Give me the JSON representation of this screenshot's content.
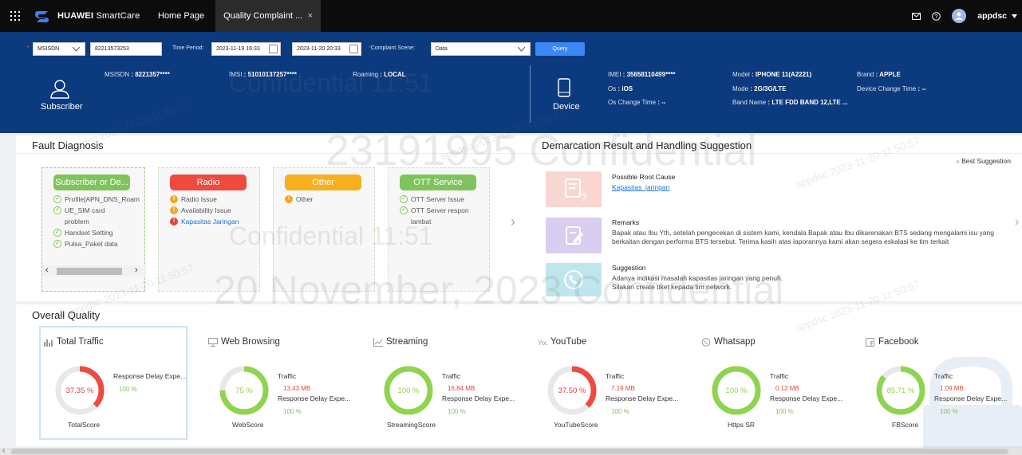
{
  "topbar": {
    "app_name_bold": "HUAWEI",
    "app_name_rest": " SmartCare",
    "tabs": [
      {
        "label": "Home Page"
      },
      {
        "label": "Quality Complaint ..."
      }
    ],
    "close_glyph": "×",
    "user": "appdsc",
    "icons": [
      "apps-grid-icon",
      "mail-icon",
      "help-icon",
      "user-icon",
      "caret-down-icon"
    ]
  },
  "query": {
    "type_select": "MSISDN",
    "msisdn_value": "82213573253",
    "time_period_label": "Time Period:",
    "start_time": "2023-11-19 16:33",
    "end_time": "2023-11-20 20:33",
    "scene_label": "Complaint Scene:",
    "scene_value": "Data",
    "query_button": "Query"
  },
  "subscriber": {
    "label": "Subscriber",
    "msisdn_key": "MSISDN",
    "msisdn_val": "8221357****",
    "imsi_key": "IMSI",
    "imsi_val": "51010137257****",
    "roaming_key": "Roaming",
    "roaming_val": "LOCAL"
  },
  "device": {
    "label": "Device",
    "imei_key": "IMEI",
    "imei_val": "35658110499****",
    "os_key": "Os",
    "os_val": "iOS",
    "os_change_key": "Os Change Time",
    "os_change_val": "--",
    "model_key": "Model",
    "model_val": "IPHONE 11(A2221)",
    "mode_key": "Mode",
    "mode_val": "2G/3G/LTE",
    "band_key": "Band Name",
    "band_val": "LTE FDD BAND 12,LTE ...",
    "brand_key": "Brand",
    "brand_val": "APPLE",
    "dev_change_key": "Device Change Time",
    "dev_change_val": "--"
  },
  "fault": {
    "title": "Fault Diagnosis",
    "cards": [
      {
        "title": "Subscriber or De...",
        "color": "#7ec45a",
        "items": [
          "Profile[APN_DNS_Roam",
          "UE_SIM card problem",
          "Handset Setting",
          "Pulsa_Paket data"
        ]
      },
      {
        "title": "Radio",
        "color": "#f0493e",
        "items": [
          "Radio Issue",
          "Availability Issue",
          "Kapasitas Jaringan"
        ]
      },
      {
        "title": "Other",
        "color": "#f6b01e",
        "items": [
          "Other"
        ]
      },
      {
        "title": "OTT Service",
        "color": "#7ec45a",
        "items": [
          "OTT Server Issue",
          "OTT Server respon lambat"
        ]
      }
    ]
  },
  "demarcation": {
    "title": "Demarcation Result and Handling Suggestion",
    "best": "Best Suggestion",
    "root_title": "Possible Root Cause",
    "root_link": "Kapasitas_jaringan",
    "remarks_title": "Remarks",
    "remarks_text": "Bapak atau Ibu Yth, setelah pengecekan di sistem kami, kendala Bapak atau Ibu dikarenakan BTS sedang mengalami isu yang berkaitan dengan performa BTS tersebut. Terima kasih atas laporannya kami akan segera eskalasi ke tim terkait",
    "sugg_title": "Suggestion",
    "sugg_line1": "Adanya indikasi masalah kapasitas jaringan yang penuh.",
    "sugg_line2": "Silakan create tiket kepada tim network."
  },
  "overall": {
    "title": "Overall Quality",
    "tabs": [
      {
        "label": "Total Traffic",
        "icon": "bar-chart-icon"
      },
      {
        "label": "Web Browsing",
        "icon": "monitor-icon"
      },
      {
        "label": "Streaming",
        "icon": "line-chart-icon"
      },
      {
        "label": "YouTube",
        "icon": "youtube-icon"
      },
      {
        "label": "Whatsapp",
        "icon": "whatsapp-icon"
      },
      {
        "label": "Facebook",
        "icon": "facebook-icon"
      }
    ],
    "scores": [
      {
        "pct_label": "37.35 %",
        "value": 37.35,
        "color": "#f0493e",
        "score_label": "TotalScore",
        "traffic_label": "",
        "traffic": "",
        "delay_label": "Response Delay Expe...",
        "delay_val": "100 %"
      },
      {
        "pct_label": "75 %",
        "value": 75,
        "color": "#8fd44f",
        "score_label": "WebScore",
        "traffic_label": "Traffic",
        "traffic": "13.43 MB",
        "delay_label": "Response Delay Expe...",
        "delay_val": "100 %"
      },
      {
        "pct_label": "100 %",
        "value": 100,
        "color": "#8fd44f",
        "score_label": "StreamingScore",
        "traffic_label": "Traffic",
        "traffic": "16.84 MB",
        "delay_label": "Response Delay Expe...",
        "delay_val": "100 %"
      },
      {
        "pct_label": "37.50 %",
        "value": 37.5,
        "color": "#f0493e",
        "score_label": "YouTubeScore",
        "traffic_label": "Traffic",
        "traffic": "7.19 MB",
        "delay_label": "Response Delay Expe...",
        "delay_val": "100 %"
      },
      {
        "pct_label": "100 %",
        "value": 100,
        "color": "#8fd44f",
        "score_label": "Https SR",
        "traffic_label": "Traffic",
        "traffic": "0.12 MB",
        "delay_label": "Response Delay Expe...",
        "delay_val": "100 %"
      },
      {
        "pct_label": "85.71 %",
        "value": 85.71,
        "color": "#8fd44f",
        "score_label": "FBScore",
        "traffic_label": "Traffic",
        "traffic": "1.09 MB",
        "delay_label": "Response Delay Expe...",
        "delay_val": "100 %"
      }
    ]
  },
  "watermark": {
    "big1": "Confidential 11:51",
    "big2": "23191995 Confidential",
    "big3": "Confidential 11:51",
    "big4": "20 November, 2023 Confidential",
    "small1": "appdsc 2023-11-20 11:50:57",
    "small2": "appdsc 2023-11-20 11:50:57",
    "small3": "appdsc 2023-11-20 11:50:57",
    "small4": "appdsc 2023-11-20 11:50:57",
    "small5": "appdsc 2023-11-20 11:50:57"
  },
  "colors": {
    "brand_band": "#0b3a7e",
    "link": "#1a6fd6",
    "accent": "#3d86f5"
  }
}
